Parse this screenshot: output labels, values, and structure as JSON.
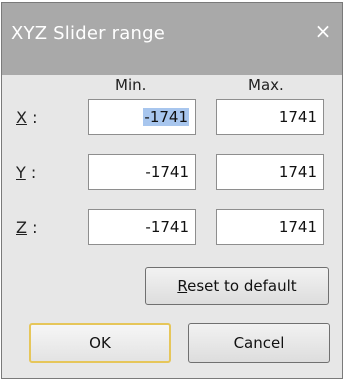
{
  "window": {
    "title": "XYZ Slider range",
    "close_glyph": "×",
    "close_icon": "close-icon"
  },
  "columns": {
    "min_header": "Min.",
    "max_header": "Max."
  },
  "rows": [
    {
      "axis": "X",
      "separator": ":",
      "min": "-1741",
      "max": "1741"
    },
    {
      "axis": "Y",
      "separator": ":",
      "min": "-1741",
      "max": "1741"
    },
    {
      "axis": "Z",
      "separator": ":",
      "min": "-1741",
      "max": "1741"
    }
  ],
  "buttons": {
    "reset_mnemonic": "R",
    "reset_rest": "eset to default",
    "ok": "OK",
    "cancel": "Cancel"
  },
  "colors": {
    "titlebar": "#a9a9a9",
    "dialog_bg": "#e7e7e7",
    "selection": "#a8c6ee",
    "default_button_border": "#e6c65a"
  }
}
